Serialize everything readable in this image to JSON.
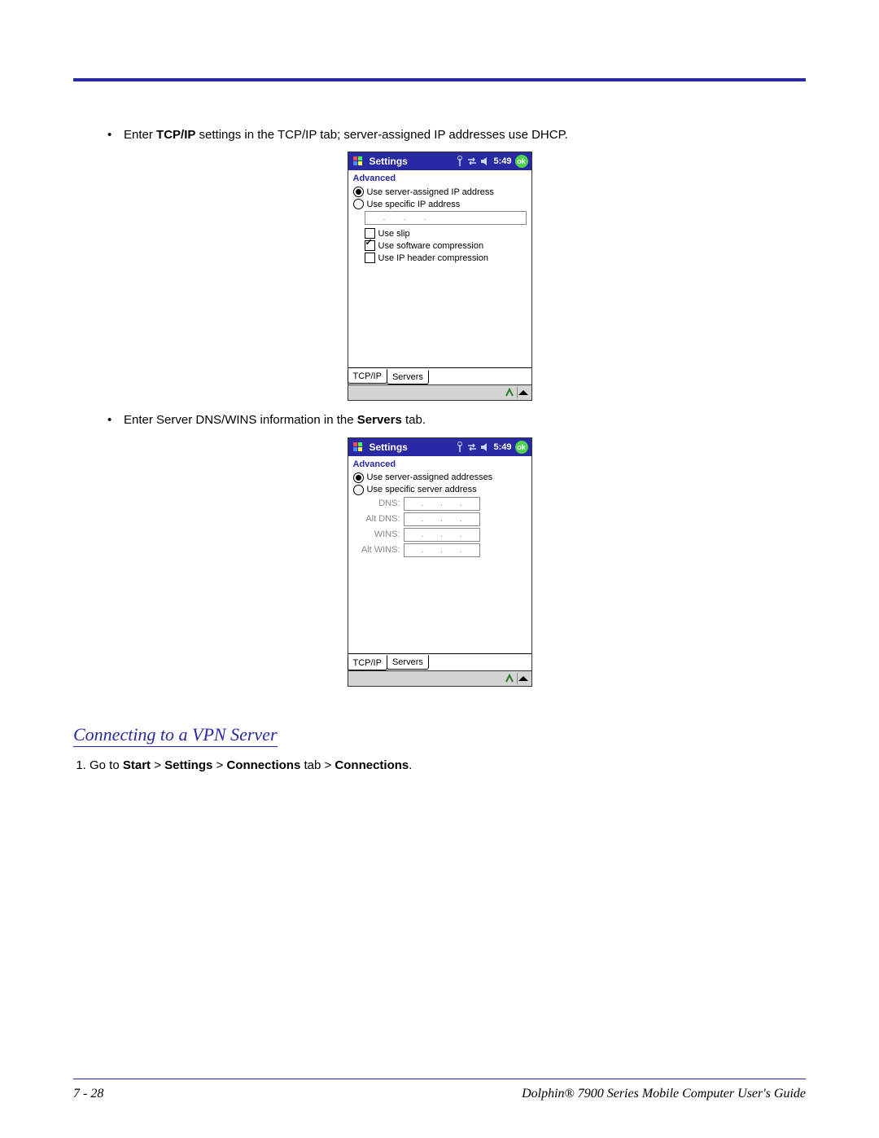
{
  "bullets": {
    "b1_pre": "Enter ",
    "b1_bold": "TCP/IP",
    "b1_post": " settings in the TCP/IP tab; server-assigned IP addresses use DHCP.",
    "b2_pre": "Enter Server DNS/WINS information in the ",
    "b2_bold": "Servers",
    "b2_post": " tab."
  },
  "section_heading": "Connecting to a VPN Server",
  "step1": {
    "pre": "Go to ",
    "start": "Start",
    "sep": " > ",
    "settings": "Settings",
    "conn_tab": "Connections",
    "tab_word": " tab > ",
    "conn": "Connections",
    "period": "."
  },
  "device_title": "Settings",
  "device_time": "5:49",
  "ok_label": "ok",
  "advanced_heading": "Advanced",
  "tcpip": {
    "radio_server": "Use server-assigned IP address",
    "radio_specific": "Use specific IP address",
    "chk_slip": "Use slip",
    "chk_swcomp": "Use software compression",
    "chk_iphdr": "Use IP header compression",
    "tab_tcpip": "TCP/IP",
    "tab_servers": "Servers"
  },
  "servers": {
    "radio_server": "Use server-assigned addresses",
    "radio_specific": "Use specific server address",
    "lbl_dns": "DNS:",
    "lbl_altdns": "Alt DNS:",
    "lbl_wins": "WINS:",
    "lbl_altwins": "Alt WINS:",
    "tab_tcpip": "TCP/IP",
    "tab_servers": "Servers"
  },
  "footer": {
    "page": "7 - 28",
    "book": "Dolphin® 7900 Series Mobile Computer User's Guide"
  }
}
